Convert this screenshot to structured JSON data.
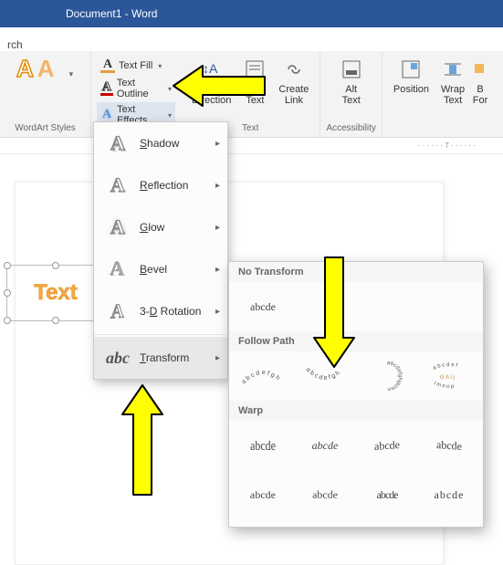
{
  "titlebar": {
    "title": "Document1 - Word"
  },
  "tabrow": {
    "partial": "rch"
  },
  "ribbon": {
    "wordart_group": "WordArt Styles",
    "textfill": {
      "fill": "Text Fill",
      "outline": "Text Outline",
      "effects": "Text Effects"
    },
    "text_group": {
      "label": "Text",
      "direction": "Text\nDirection",
      "align": "Align\nText",
      "link": "Create\nLink"
    },
    "accessibility_group": {
      "label": "Accessibility",
      "alt": "Alt\nText"
    },
    "arrange_group": {
      "position": "Position",
      "wrap": "Wrap\nText",
      "bring": "B\nFor"
    }
  },
  "ruler": {
    "mark": "· · · · · · 7 · · · · · ·"
  },
  "textbox": {
    "text": "Text"
  },
  "fx_menu": {
    "items": [
      {
        "label": "Shadow",
        "accel": "S"
      },
      {
        "label": "Reflection",
        "accel": "R"
      },
      {
        "label": "Glow",
        "accel": "G"
      },
      {
        "label": "Bevel",
        "accel": "B"
      },
      {
        "label": "3-D Rotation",
        "accel": "D"
      },
      {
        "label": "Transform",
        "accel": "T"
      }
    ]
  },
  "transform": {
    "no_transform": "No Transform",
    "sample": "abcde",
    "follow_path": "Follow Path",
    "warp": "Warp"
  }
}
